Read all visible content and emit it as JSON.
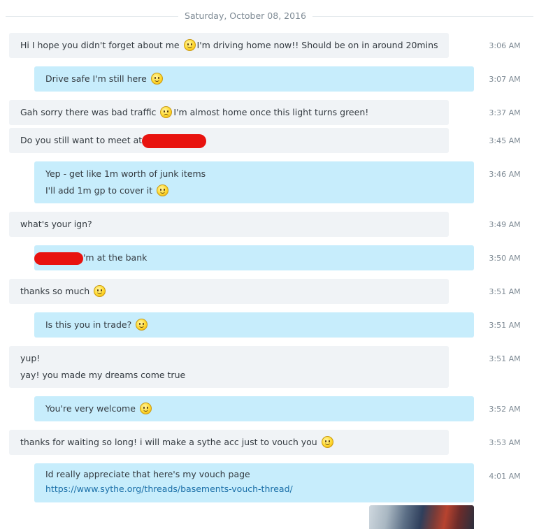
{
  "date_separator": "Saturday, October 08, 2016",
  "messages": [
    {
      "dir": "in",
      "time": "3:06 AM",
      "lines": [
        [
          "Hi I hope you didn't forget about me ",
          "I'm driving home now!! Should be on in around 20mins"
        ]
      ]
    },
    {
      "dir": "out",
      "time": "3:07 AM",
      "lines": [
        [
          "Drive safe I'm still here ",
          ""
        ]
      ]
    },
    {
      "dir": "in",
      "time": "3:37 AM",
      "lines": [
        [
          "Gah sorry there was bad traffic ",
          "I'm almost home once this light turns green!"
        ]
      ]
    },
    {
      "dir": "in",
      "time": "3:45 AM",
      "lines": [
        [
          "Do you still want to meet at "
        ]
      ]
    },
    {
      "dir": "out",
      "time": "3:46 AM",
      "lines": [
        [
          "Yep - get like 1m worth of junk items"
        ],
        [
          "I'll add 1m gp to cover it ",
          ""
        ]
      ]
    },
    {
      "dir": "in",
      "time": "3:49 AM",
      "lines": [
        [
          "what's your ign?"
        ]
      ]
    },
    {
      "dir": "out",
      "time": "3:50 AM",
      "lines": [
        [
          "'m at the bank"
        ]
      ]
    },
    {
      "dir": "in",
      "time": "3:51 AM",
      "lines": [
        [
          "thanks so much ",
          ""
        ]
      ]
    },
    {
      "dir": "out",
      "time": "3:51 AM",
      "lines": [
        [
          "Is this you in trade? ",
          ""
        ]
      ]
    },
    {
      "dir": "in",
      "time": "3:51 AM",
      "lines": [
        [
          "yup!"
        ],
        [
          "yay! you made my dreams come true"
        ]
      ]
    },
    {
      "dir": "out",
      "time": "3:52 AM",
      "lines": [
        [
          "You're very welcome ",
          ""
        ]
      ]
    },
    {
      "dir": "in",
      "time": "3:53 AM",
      "lines": [
        [
          "thanks for waiting so long! i will make a sythe acc just to vouch you ",
          ""
        ]
      ]
    },
    {
      "dir": "out",
      "time": "4:01 AM",
      "lines": [
        [
          "Id really appreciate that here's my vouch page"
        ]
      ],
      "link": "https://www.sythe.org/threads/basements-vouch-thread/"
    }
  ],
  "emoji_names": [
    "smile-emoji-icon",
    "sad-emoji-icon"
  ],
  "attachment": {
    "kind": "image-thumbnail"
  },
  "colors": {
    "incoming_bubble": "#f0f3f6",
    "outgoing_bubble": "#c7edfc",
    "link": "#1a6fa8",
    "timestamp": "#7f8b95",
    "redaction": "#e8130f"
  }
}
